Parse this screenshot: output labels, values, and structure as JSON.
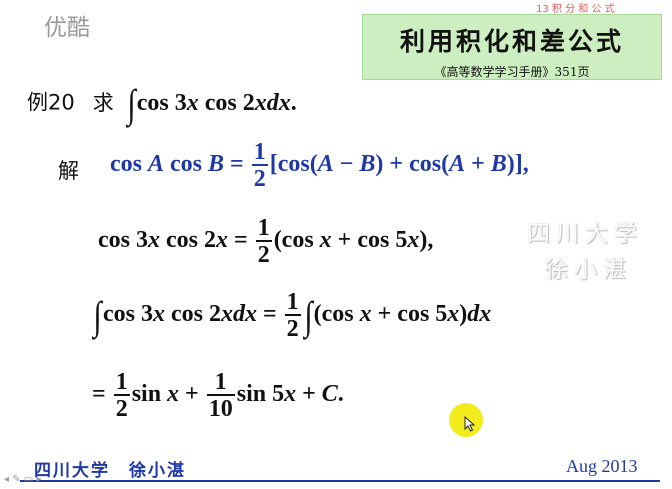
{
  "logo": "优酷",
  "top_strip": "13 积 分 和 公 式",
  "title": {
    "main": "利用积化和差公式",
    "source": "《高等数学学习手册》351页"
  },
  "example": {
    "label": "例20",
    "prompt": "求"
  },
  "solution_label": "解",
  "watermark": {
    "line1": "四川大学",
    "line2": "徐小湛"
  },
  "footer": {
    "author": "四川大学　徐小湛",
    "date": "Aug 2013"
  },
  "nav_icons": [
    "left-arrow-icon",
    "pen-icon",
    "menu-icon",
    "right-arrow-icon"
  ],
  "colors": {
    "title_bg": "#cdeec0",
    "formula_blue": "#1f38a8",
    "cursor_highlight": "#f3ec1c"
  }
}
